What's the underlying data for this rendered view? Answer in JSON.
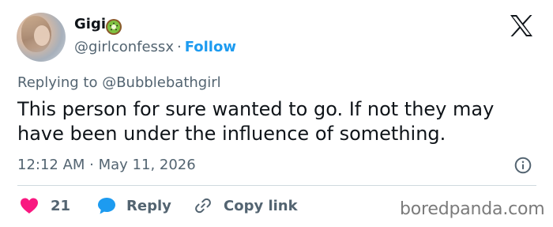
{
  "author": {
    "display_name": "Gigi",
    "name_emoji": "kiwi-emoji",
    "handle": "@girlconfessx",
    "separator": "·",
    "follow_label": "Follow"
  },
  "reply_context": {
    "text": "Replying to @Bubblebathgirl"
  },
  "tweet": {
    "text": "This person for sure wanted to go. If not they may have been under the influence of something.",
    "timestamp": "12:12 AM · May 11, 2026"
  },
  "actions": {
    "like_count": "21",
    "reply_label": "Reply",
    "copy_link_label": "Copy link"
  },
  "watermark": {
    "text": "boredpanda.com"
  },
  "colors": {
    "accent": "#1d9bf0",
    "like": "#f91880",
    "secondary_text": "#536471",
    "primary_text": "#0f1419"
  },
  "icons": {
    "platform_logo": "x-logo-icon",
    "info": "info-icon",
    "like": "heart-icon",
    "reply": "speech-bubble-icon",
    "copy_link": "link-icon"
  }
}
